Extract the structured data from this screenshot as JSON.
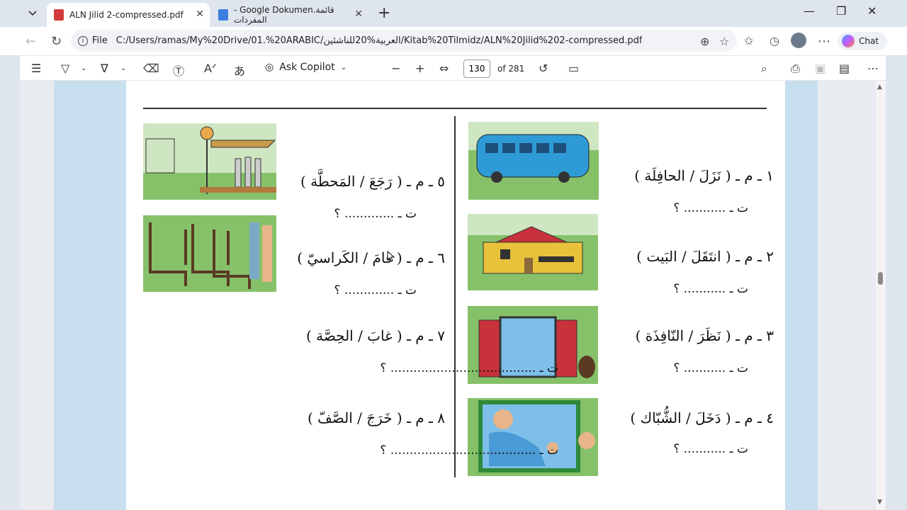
{
  "tabs": [
    {
      "title": "ALN Jilid 2-compressed.pdf",
      "icon": "pdf-icon",
      "active": true
    },
    {
      "title": "- Google Dokumen.قائمة المفردات",
      "icon": "google-docs-icon",
      "active": false
    }
  ],
  "address": {
    "scheme_label": "File",
    "url": "C:/Users/ramas/My%20Drive/01.%20ARABIC/العربية%20للناشئين/Kitab%20Tilmidz/ALN%20Jilid%202-compressed.pdf"
  },
  "chat_label": "Chat",
  "pdf_toolbar": {
    "ask_copilot": "Ask Copilot",
    "page_current": "130",
    "page_total": "of 281"
  },
  "exercises": [
    {
      "num": "١",
      "question": "١ ـ م ـ ( نَزَلَ / الحافِلَة )",
      "answer": "ت ـ ........... ؟"
    },
    {
      "num": "٢",
      "question": "٢ ـ م ـ ( انتَقَلَ / البَيت )",
      "answer": "ت ـ ........... ؟"
    },
    {
      "num": "٣",
      "question": "٣ ـ م ـ ( نَظَرَ / النّافِذَة )",
      "answer": "ت ـ ........... ؟"
    },
    {
      "num": "٤",
      "question": "٤ ـ م ـ ( دَخَلَ / الشُّبّاك )",
      "answer": "ت ـ ........... ؟"
    },
    {
      "num": "٥",
      "question": "٥ ـ م ـ ( رَجَعَ / المَحطَّة )",
      "answer": "ت ـ ............. ؟"
    },
    {
      "num": "٦",
      "question": "٦ ـ م ـ ( قامَ / الكَراسيّ )",
      "answer": "ت ـ ............. ؟"
    },
    {
      "num": "٧",
      "question": "٧ ـ م ـ ( غابَ / الحِصَّة )",
      "answer": "ت ـ ...................................... ؟"
    },
    {
      "num": "٨",
      "question": "٨ ـ م ـ ( خَرَجَ / الصَّفّ )",
      "answer": "ت ـ ...................................... ؟"
    }
  ],
  "colors": {
    "page_bg": "#c7dfee",
    "bus": "#2f9bd6",
    "grass": "#86c16a",
    "house": "#e8c23a",
    "roof": "#c8323c",
    "shutter": "#c8323c"
  }
}
